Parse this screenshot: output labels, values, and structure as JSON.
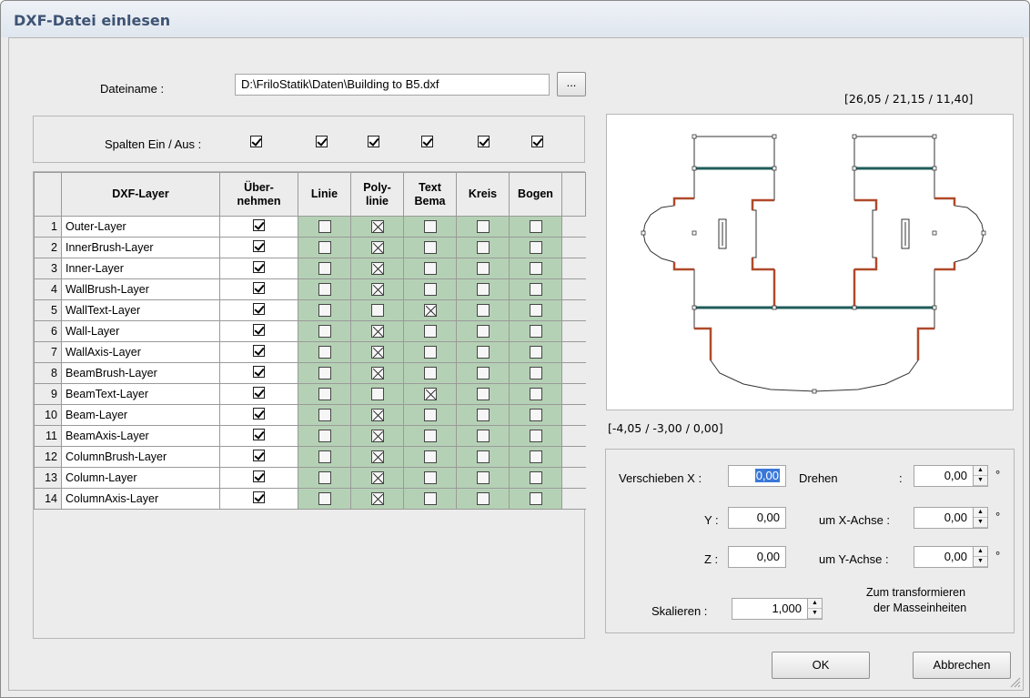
{
  "window": {
    "title": "DXF-Datei einlesen"
  },
  "file": {
    "label": "Dateiname :",
    "value": "D:\\FriloStatik\\Daten\\Building to B5.dxf",
    "browse_label": "..."
  },
  "columns_toggle": {
    "label": "Spalten Ein / Aus :",
    "checks": [
      true,
      true,
      true,
      true,
      true,
      true
    ]
  },
  "table": {
    "headers": {
      "layer": "DXF-Layer",
      "take_1": "Über-",
      "take_2": "nehmen",
      "line": "Linie",
      "poly_1": "Poly-",
      "poly_2": "linie",
      "text_1": "Text",
      "text_2": "Bema",
      "circle": "Kreis",
      "arc": "Bogen"
    },
    "rows": [
      {
        "num": "1",
        "name": "Outer-Layer",
        "take": true,
        "line": false,
        "poly": true,
        "text": false,
        "circle": false,
        "arc": false
      },
      {
        "num": "2",
        "name": "InnerBrush-Layer",
        "take": true,
        "line": false,
        "poly": true,
        "text": false,
        "circle": false,
        "arc": false
      },
      {
        "num": "3",
        "name": "Inner-Layer",
        "take": true,
        "line": false,
        "poly": true,
        "text": false,
        "circle": false,
        "arc": false
      },
      {
        "num": "4",
        "name": "WallBrush-Layer",
        "take": true,
        "line": false,
        "poly": true,
        "text": false,
        "circle": false,
        "arc": false
      },
      {
        "num": "5",
        "name": "WallText-Layer",
        "take": true,
        "line": false,
        "poly": false,
        "text": true,
        "circle": false,
        "arc": false
      },
      {
        "num": "6",
        "name": "Wall-Layer",
        "take": true,
        "line": false,
        "poly": true,
        "text": false,
        "circle": false,
        "arc": false
      },
      {
        "num": "7",
        "name": "WallAxis-Layer",
        "take": true,
        "line": false,
        "poly": true,
        "text": false,
        "circle": false,
        "arc": false
      },
      {
        "num": "8",
        "name": "BeamBrush-Layer",
        "take": true,
        "line": false,
        "poly": true,
        "text": false,
        "circle": false,
        "arc": false
      },
      {
        "num": "9",
        "name": "BeamText-Layer",
        "take": true,
        "line": false,
        "poly": false,
        "text": true,
        "circle": false,
        "arc": false
      },
      {
        "num": "10",
        "name": "Beam-Layer",
        "take": true,
        "line": false,
        "poly": true,
        "text": false,
        "circle": false,
        "arc": false
      },
      {
        "num": "11",
        "name": "BeamAxis-Layer",
        "take": true,
        "line": false,
        "poly": true,
        "text": false,
        "circle": false,
        "arc": false
      },
      {
        "num": "12",
        "name": "ColumnBrush-Layer",
        "take": true,
        "line": false,
        "poly": true,
        "text": false,
        "circle": false,
        "arc": false
      },
      {
        "num": "13",
        "name": "Column-Layer",
        "take": true,
        "line": false,
        "poly": true,
        "text": false,
        "circle": false,
        "arc": false
      },
      {
        "num": "14",
        "name": "ColumnAxis-Layer",
        "take": true,
        "line": false,
        "poly": true,
        "text": false,
        "circle": false,
        "arc": false
      }
    ]
  },
  "preview": {
    "max_coords": "[26,05 / 21,15 / 11,40]",
    "min_coords": "[-4,05 / -3,00 / 0,00]",
    "wall_color": "#b04a2a",
    "beam_color": "#1f5c5a"
  },
  "transform": {
    "move_label": "Verschieben  X :",
    "x_value": "0,00",
    "y_label": "Y :",
    "y_value": "0,00",
    "z_label": "Z :",
    "z_value": "0,00",
    "rotate_label": "Drehen",
    "rotate_colon": ":",
    "rotate_value": "0,00",
    "rot_x_label": "um X-Achse :",
    "rot_x_value": "0,00",
    "rot_y_label": "um Y-Achse :",
    "rot_y_value": "0,00",
    "degree": "°",
    "scale_label": "Skalieren :",
    "scale_value": "1,000",
    "scale_note_1": "Zum transformieren",
    "scale_note_2": "der Masseinheiten"
  },
  "buttons": {
    "ok": "OK",
    "cancel": "Abbrechen"
  }
}
